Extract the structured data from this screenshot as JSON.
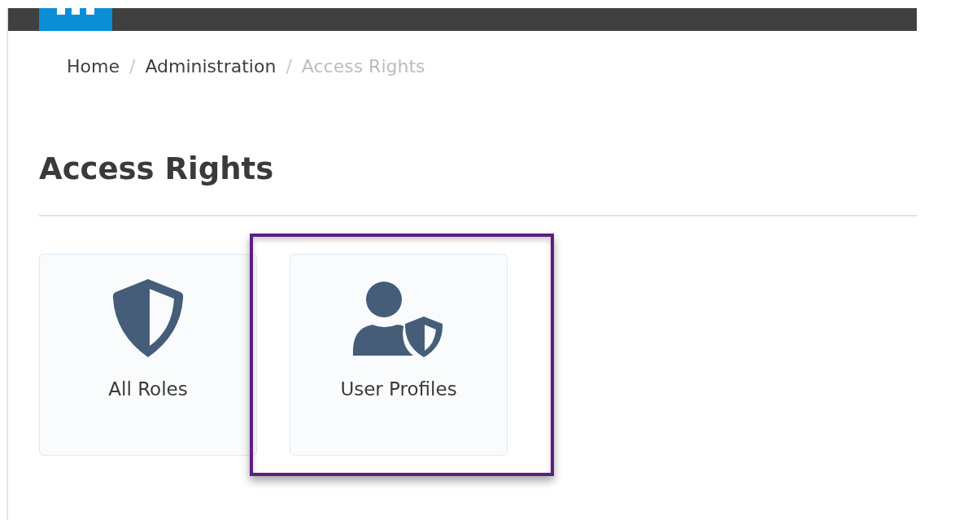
{
  "breadcrumb": [
    {
      "label": "Home",
      "current": false
    },
    {
      "label": "Administration",
      "current": false
    },
    {
      "label": "Access Rights",
      "current": true
    }
  ],
  "separator": "/",
  "heading": "Access Rights",
  "tiles": [
    {
      "label": "All Roles",
      "kind": "shield",
      "highlighted": false
    },
    {
      "label": "User Profiles",
      "kind": "user-shield",
      "highlighted": true
    }
  ]
}
